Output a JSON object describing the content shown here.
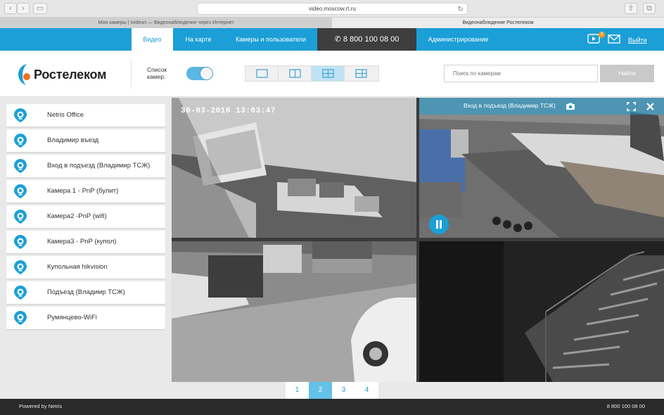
{
  "browser": {
    "url": "video.moscow.rt.ru",
    "tabs": [
      "Мои камеры | Ivideon — Видеонаблюдение через Интернет",
      "Видеонаблюдение Ростелеком"
    ]
  },
  "topnav": {
    "items": [
      "Видео",
      "На карте",
      "Камеры и пользователи"
    ],
    "phone": "8 800 100 08 00",
    "admin": "Администрирование",
    "notification_count": "3",
    "logout": "Выйти"
  },
  "header": {
    "logo_text": "Ростелеком",
    "camera_list_label": "Список камер:",
    "search_placeholder": "Поиск по камерам",
    "search_button": "Найти"
  },
  "cameras": [
    "Netris Office",
    "Владимир въезд",
    "Вход в подъезд (Владимир ТСЖ)",
    "Камера 1 - PnP (булит)",
    "Камера2 -PnP (wifi)",
    "Камера3 - PnP (купол)",
    "Купольная hikvision",
    "Подъезд (Владимр ТСЖ)",
    "Румянцево-WiFi"
  ],
  "video": {
    "timestamp": "30-03-2016 13:03:47",
    "active_title": "Вход в подъезд (Владимир ТСЖ)"
  },
  "pagination": [
    "1",
    "2",
    "3",
    "4"
  ],
  "footer": {
    "powered": "Powered by Netris",
    "phone": "8 800 100 08 00"
  },
  "colors": {
    "accent": "#1b9fd6",
    "dark": "#2a2a2a"
  }
}
